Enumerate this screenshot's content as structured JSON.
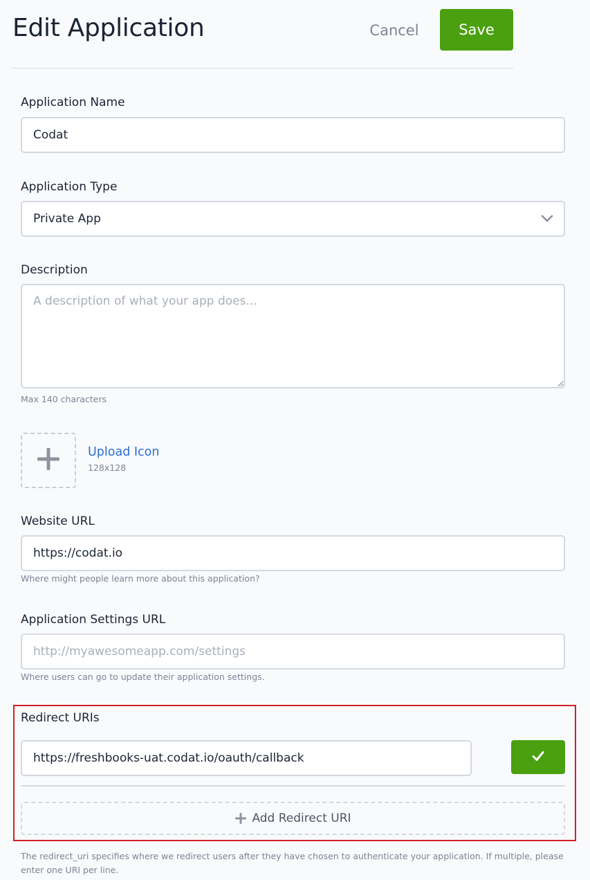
{
  "header": {
    "title": "Edit Application",
    "cancel_label": "Cancel",
    "save_label": "Save"
  },
  "form": {
    "app_name": {
      "label": "Application Name",
      "value": "Codat"
    },
    "app_type": {
      "label": "Application Type",
      "value": "Private App",
      "icon": "chevron-down-icon"
    },
    "description": {
      "label": "Description",
      "placeholder": "A description of what your app does...",
      "value": "",
      "hint": "Max 140 characters"
    },
    "upload_icon": {
      "link_label": "Upload Icon",
      "size_text": "128x128",
      "icon": "plus-icon"
    },
    "website_url": {
      "label": "Website URL",
      "value": "https://codat.io",
      "hint": "Where might people learn more about this application?"
    },
    "settings_url": {
      "label": "Application Settings URL",
      "placeholder": "http://myawesomeapp.com/settings",
      "value": "",
      "hint": "Where users can go to update their application settings."
    },
    "redirect_uris": {
      "label": "Redirect URIs",
      "items": [
        {
          "value": "https://freshbooks-uat.codat.io/oauth/callback"
        }
      ],
      "confirm_icon": "checkmark-icon",
      "add_label": "Add Redirect URI",
      "hint": "The redirect_uri specifies where we redirect users after they have chosen to authenticate your application. If multiple, please enter one URI per line."
    }
  },
  "colors": {
    "accent_green": "#4aa00f",
    "link_blue": "#2b6ed2",
    "highlight_red": "#d21f26",
    "background": "#f9fafc"
  }
}
